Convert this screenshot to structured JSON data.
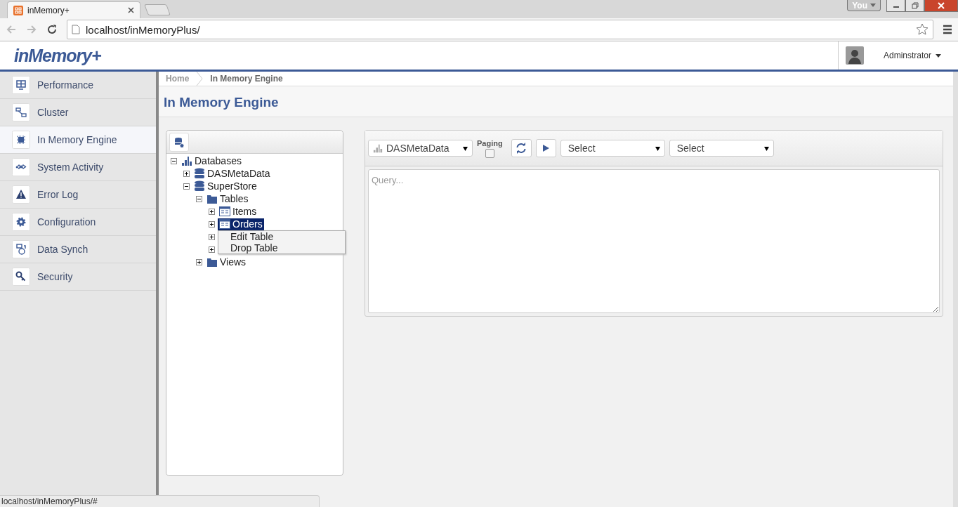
{
  "browser": {
    "tab_title": "inMemory+",
    "profile_button": "You",
    "address": "localhost/inMemoryPlus/",
    "status_url": "localhost/inMemoryPlus/#"
  },
  "header": {
    "logo": "inMemory+",
    "user": "Adminstrator"
  },
  "sidebar": {
    "items": [
      {
        "label": "Performance",
        "selected": false
      },
      {
        "label": "Cluster",
        "selected": false
      },
      {
        "label": "In Memory Engine",
        "selected": true
      },
      {
        "label": "System Activity",
        "selected": false
      },
      {
        "label": "Error Log",
        "selected": false
      },
      {
        "label": "Configuration",
        "selected": false
      },
      {
        "label": "Data Synch",
        "selected": false
      },
      {
        "label": "Security",
        "selected": false
      }
    ]
  },
  "breadcrumb": [
    "Home",
    "In Memory Engine"
  ],
  "page_title": "In Memory Engine",
  "tree": [
    {
      "label": "Databases",
      "kind": "root",
      "expanded": true,
      "selected": false,
      "children": [
        {
          "label": "DASMetaData",
          "kind": "database",
          "expanded": false,
          "selected": false
        },
        {
          "label": "SuperStore",
          "kind": "database",
          "expanded": true,
          "selected": false,
          "children": [
            {
              "label": "Tables",
              "kind": "folder",
              "expanded": true,
              "selected": false,
              "children": [
                {
                  "label": "Items",
                  "kind": "table",
                  "expanded": false,
                  "selected": false
                },
                {
                  "label": "Orders",
                  "kind": "table",
                  "expanded": false,
                  "selected": true
                },
                {
                  "kind": "hidden",
                  "expanded": false
                },
                {
                  "kind": "hidden",
                  "expanded": false
                }
              ]
            },
            {
              "label": "Views",
              "kind": "folder",
              "expanded": false,
              "selected": false
            }
          ]
        }
      ]
    }
  ],
  "context_menu": [
    "Edit Table",
    "Drop Table"
  ],
  "query_toolbar": {
    "database": "DASMetaData",
    "paging_label": "Paging",
    "paging": false,
    "selects": [
      "Select",
      "Select"
    ]
  },
  "query": {
    "placeholder": "Query..."
  }
}
